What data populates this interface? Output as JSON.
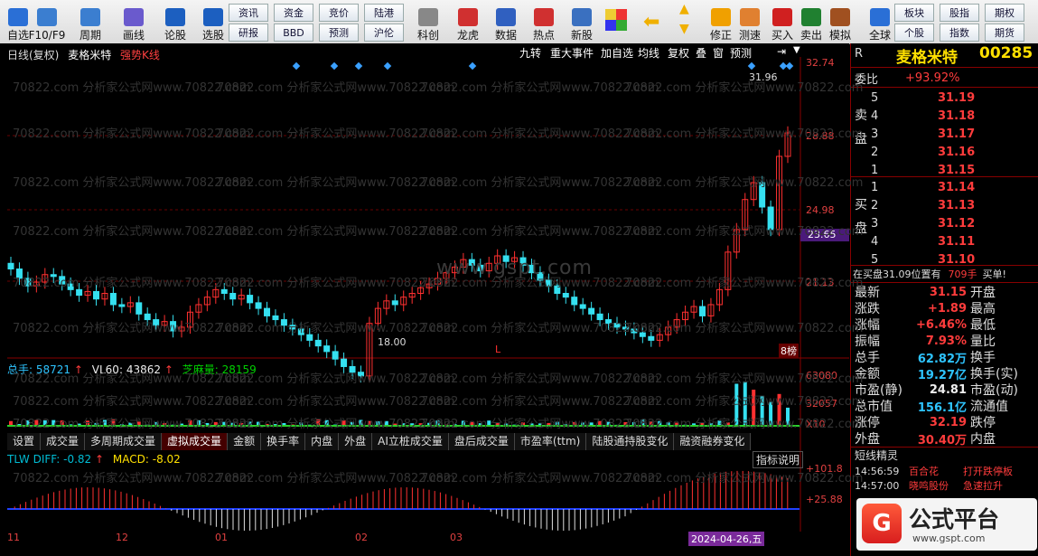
{
  "toolbar": {
    "items": [
      {
        "label": "自选",
        "icon": "self-select-icon"
      },
      {
        "label": "F10/F9",
        "icon": "f10-icon"
      },
      {
        "label": "周期",
        "icon": "period-icon"
      },
      {
        "label": "画线",
        "icon": "draw-line-icon"
      },
      {
        "label": "论股",
        "icon": "discuss-icon"
      },
      {
        "label": "选股",
        "icon": "select-stock-icon"
      },
      {
        "label": "科创",
        "icon": "kechuang-icon"
      },
      {
        "label": "龙虎",
        "icon": "longhu-icon"
      },
      {
        "label": "数据",
        "icon": "data-icon"
      },
      {
        "label": "热点",
        "icon": "hot-icon"
      },
      {
        "label": "新股",
        "icon": "new-stock-icon"
      },
      {
        "label": "修正",
        "icon": "fix-icon"
      },
      {
        "label": "测速",
        "icon": "speed-icon"
      },
      {
        "label": "买入",
        "icon": "buy-icon"
      },
      {
        "label": "卖出",
        "icon": "sell-icon"
      },
      {
        "label": "模拟",
        "icon": "simulate-icon"
      },
      {
        "label": "全球",
        "icon": "globe-icon"
      }
    ],
    "small_buttons": [
      "资讯",
      "资金",
      "竞价",
      "陆港",
      "研报",
      "BBD",
      "预测",
      "沪伦",
      "板块",
      "股指",
      "期权",
      "个股",
      "指数",
      "期货"
    ],
    "buy_char": "买",
    "sell_char": "卖"
  },
  "chart": {
    "header": {
      "period": "日线(复权)",
      "name": "麦格米特",
      "mode": "强势K线"
    },
    "buttons": [
      "九转",
      "重大事件",
      "加自选",
      "均线",
      "复权",
      "叠",
      "窗",
      "预测"
    ],
    "price_scale": [
      "32.74",
      "28.88",
      "24.98",
      "23.65",
      "21.13"
    ],
    "high_label": "31.96",
    "low_label": "18.00",
    "watermark_site": "www.gspt.com",
    "watermark_text": "70822.com 分析家公式网www.70822.com",
    "flag": "L",
    "side_tag": "8榜",
    "volume": {
      "total_label": "总手:",
      "total": "58721",
      "vl60_label": "VL60:",
      "vl60": "43862",
      "zhima_label": "芝麻量:",
      "zhima": "28159",
      "scale": [
        "63080",
        "32057",
        "X10"
      ]
    },
    "tabs": [
      "设置",
      "成交量",
      "多周期成交量",
      "虚拟成交量",
      "金额",
      "换手率",
      "内盘",
      "外盘",
      "AI立桩成交量",
      "盘后成交量",
      "市盈率(ttm)",
      "陆股通持股变化",
      "融资融券变化"
    ],
    "active_tab": "虚拟成交量",
    "macd": {
      "diff_label": "TLW DIFF:",
      "diff": "-0.82",
      "macd_label": "MACD:",
      "macd": "-8.02",
      "btn": "指标说明",
      "scale": [
        "+101.8",
        "+25.88"
      ]
    },
    "date_axis": [
      "11",
      "12",
      "01",
      "02",
      "03",
      "2024-04-26,五"
    ]
  },
  "panel": {
    "r": "R",
    "title": "麦格米特",
    "code": "00285",
    "wb_label": "委比",
    "wb_value": "+93.92%",
    "sell_label": "卖盘",
    "buy_label": "买盘",
    "sells": [
      {
        "n": "5",
        "p": "31.19"
      },
      {
        "n": "4",
        "p": "31.18"
      },
      {
        "n": "3",
        "p": "31.17"
      },
      {
        "n": "2",
        "p": "31.16"
      },
      {
        "n": "1",
        "p": "31.15"
      }
    ],
    "buys": [
      {
        "n": "1",
        "p": "31.14"
      },
      {
        "n": "2",
        "p": "31.13"
      },
      {
        "n": "3",
        "p": "31.12"
      },
      {
        "n": "4",
        "p": "31.11"
      },
      {
        "n": "5",
        "p": "31.10"
      }
    ],
    "buy_info": "在买盘31.09位置有",
    "buy_info_qty": "709手",
    "buy_info_tail": "买单!",
    "quotes": [
      {
        "k": "最新",
        "v": "31.15",
        "k2": "开盘"
      },
      {
        "k": "涨跌",
        "v": "+1.89",
        "k2": "最高"
      },
      {
        "k": "涨幅",
        "v": "+6.46%",
        "k2": "最低"
      },
      {
        "k": "振幅",
        "v": "7.93%",
        "k2": "量比"
      },
      {
        "k": "总手",
        "v": "62.82万",
        "k2": "换手"
      },
      {
        "k": "金额",
        "v": "19.27亿",
        "k2": "换手(实)"
      },
      {
        "k": "市盈(静)",
        "v": "24.81",
        "k2": "市盈(动)"
      },
      {
        "k": "总市值",
        "v": "156.1亿",
        "k2": "流通值"
      },
      {
        "k": "涨停",
        "v": "32.19",
        "k2": "跌停"
      },
      {
        "k": "外盘",
        "v": "30.40万",
        "k2": "内盘"
      }
    ],
    "sprite_title": "短线精灵",
    "sprites": [
      {
        "t": "14:56:59",
        "n": "百合花",
        "e": "打开跌停板"
      },
      {
        "t": "14:57:00",
        "n": "晓鸣股份",
        "e": "急速拉升"
      }
    ],
    "logo_text": "公式平台",
    "logo_url": "www.gspt.com"
  }
}
